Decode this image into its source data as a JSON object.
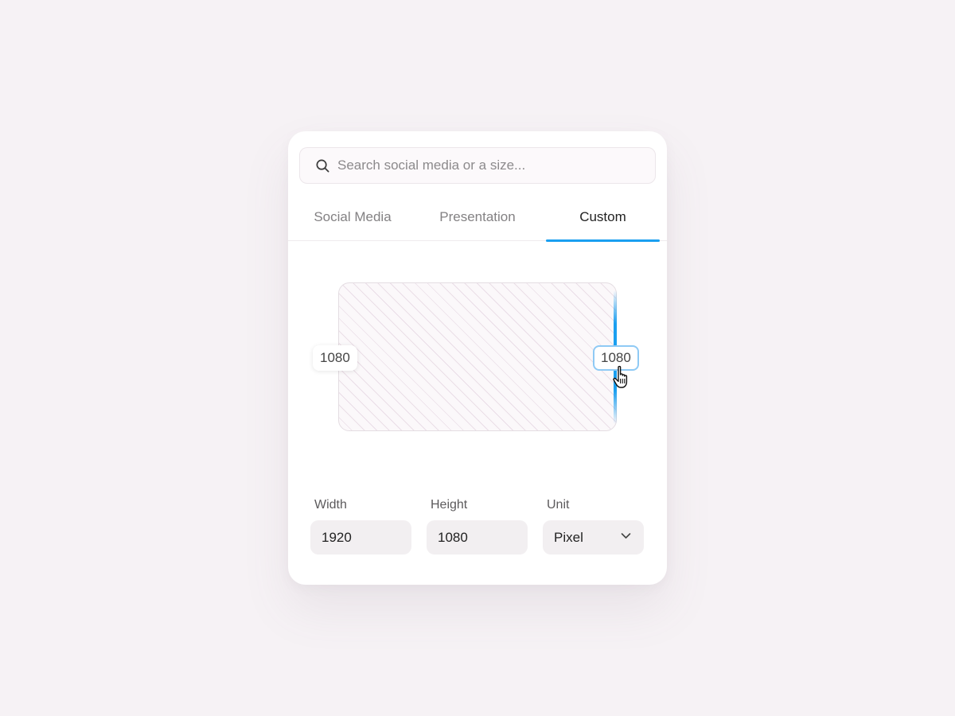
{
  "search": {
    "placeholder": "Search social media or a size...",
    "icon": "search-icon"
  },
  "tabs": [
    {
      "label": "Social Media",
      "active": false
    },
    {
      "label": "Presentation",
      "active": false
    },
    {
      "label": "Custom",
      "active": true
    }
  ],
  "preview": {
    "height_tag": "1080",
    "width_tag": "1080"
  },
  "fields": {
    "width": {
      "label": "Width",
      "value": "1920"
    },
    "height": {
      "label": "Height",
      "value": "1080"
    },
    "unit": {
      "label": "Unit",
      "value": "Pixel",
      "icon": "chevron-down-icon"
    }
  },
  "colors": {
    "accent": "#1a9ff0",
    "background": "#f6f2f5",
    "card": "#ffffff",
    "field_bg": "#f2eff1"
  }
}
